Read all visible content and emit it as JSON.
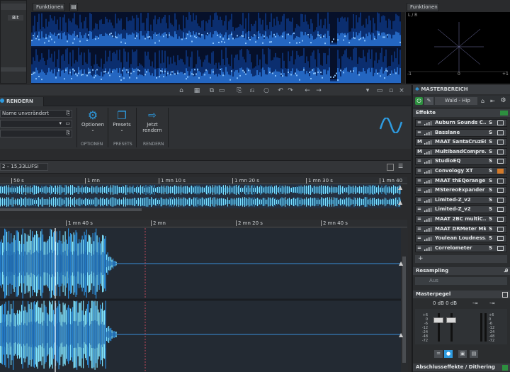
{
  "top_left": {
    "col_label": "Bit"
  },
  "spectrum_tabs": {
    "left": "Funktionen",
    "right": "Funktionen"
  },
  "phase_scope": {
    "label": "L / R",
    "axis_min": "-1",
    "axis_mid": "0",
    "axis_max": "+1"
  },
  "render_panel": {
    "tab_label": "RENDERN",
    "name_field": "Name unverändert",
    "groups": [
      {
        "button": "Optionen",
        "group": "OPTIONEN"
      },
      {
        "button": "Presets",
        "group": "PRESETS"
      },
      {
        "button": "Jetzt\nrendern",
        "button_l1": "Jetzt",
        "button_l2": "rendern",
        "group": "RENDERN"
      }
    ]
  },
  "track": {
    "loudness": "2 – 15,33LUFSi"
  },
  "overview_ruler": [
    "50 s",
    "1 mn",
    "1 mn 10 s",
    "1 mn 20 s",
    "1 mn 30 s",
    "1 mn 40"
  ],
  "main_ruler": [
    "1 mn 40 s",
    "2 mn",
    "2 mn 20 s",
    "2 mn 40 s"
  ],
  "masterbereich": {
    "title": "MASTERBEREICH",
    "preset": "Wald - Hip",
    "effekte_label": "Effekte",
    "effects": [
      {
        "mode": "=",
        "name": "Auburn Sounds C...",
        "s": "S"
      },
      {
        "mode": "=",
        "name": "Basslane",
        "s": "S"
      },
      {
        "mode": "M",
        "name": "MAAT SantaCruzEQ",
        "s": "S"
      },
      {
        "mode": "M",
        "name": "MultibandCompre...",
        "s": "S"
      },
      {
        "mode": "=",
        "name": "StudioEQ",
        "s": "S"
      },
      {
        "mode": "=",
        "name": "Convology XT",
        "s": "S"
      },
      {
        "mode": "=",
        "name": "MAAT thEQorange",
        "s": "S"
      },
      {
        "mode": "=",
        "name": "MStereoExpander",
        "s": "S"
      },
      {
        "mode": "=",
        "name": "Limited-Z_v2",
        "s": "S"
      },
      {
        "mode": "=",
        "name": "Limited-Z_v2",
        "s": "S"
      },
      {
        "mode": "=",
        "name": "MAAT 2BC multiC...",
        "s": "S"
      },
      {
        "mode": "=",
        "name": "MAAT DRMeter MkI",
        "s": "S"
      },
      {
        "mode": "=",
        "name": "Youlean Loudness...",
        "s": "S"
      },
      {
        "mode": "=",
        "name": "Correlometer",
        "s": "S"
      }
    ],
    "add_label": "+",
    "resampling_label": "Resampling",
    "resampling_value": "Aus",
    "masterpegel_label": "Masterpegel",
    "level_readout": "0 dB  0 dB",
    "inf_left": "-∞",
    "inf_right": "-∞",
    "scale": [
      "+6",
      "0",
      "-6",
      "-12",
      "-24",
      "-48",
      "-72"
    ],
    "abschluss_label": "Abschlusseffekte / Dithering"
  },
  "colors": {
    "accent": "#2e9be0",
    "spectrum_bg": "#06102a",
    "wave_light": "#7fe3ff",
    "wave_dark": "#1e6fbf"
  }
}
